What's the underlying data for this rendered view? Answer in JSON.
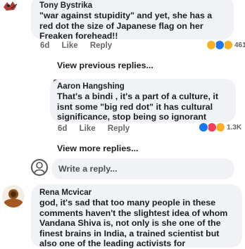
{
  "comment1": {
    "author": "Tony Bystrika",
    "text": "\"war against stupidity\" and yet, she has a red dot the size of Japanese flag on her Freaken forehead!!",
    "age": "6d",
    "like_label": "Like",
    "reply_label": "Reply",
    "reaction_count": "461",
    "reactions": [
      "haha",
      "like",
      "laugh"
    ]
  },
  "view_previous_label": "View previous replies...",
  "reply1": {
    "author": "Aaron Hangshing",
    "text": "That's a bindi , it's a part of a culture, it isnt some \"big red dot\" it has cultural significance, stop being so ignorant",
    "age": "6d",
    "like_label": "Like",
    "reply_label": "Reply",
    "reaction_count": "1.3K",
    "reactions": [
      "like",
      "love",
      "haha"
    ]
  },
  "view_more_label": "View more replies...",
  "write_reply": {
    "placeholder": "Write a reply..."
  },
  "comment2": {
    "author": "Rena Mcvicar",
    "text": "god, it's sad that too many people in these comments haven't the slightest idea of whom Vandana Shiva is, not only is she one of the finest brains in India, a trained scientist but also one of the leading activists for"
  },
  "colors": {
    "like": "#1877f2",
    "love": "#f33e58",
    "haha": "#f7b125",
    "text": "#1c1e21",
    "meta": "#65676b"
  }
}
